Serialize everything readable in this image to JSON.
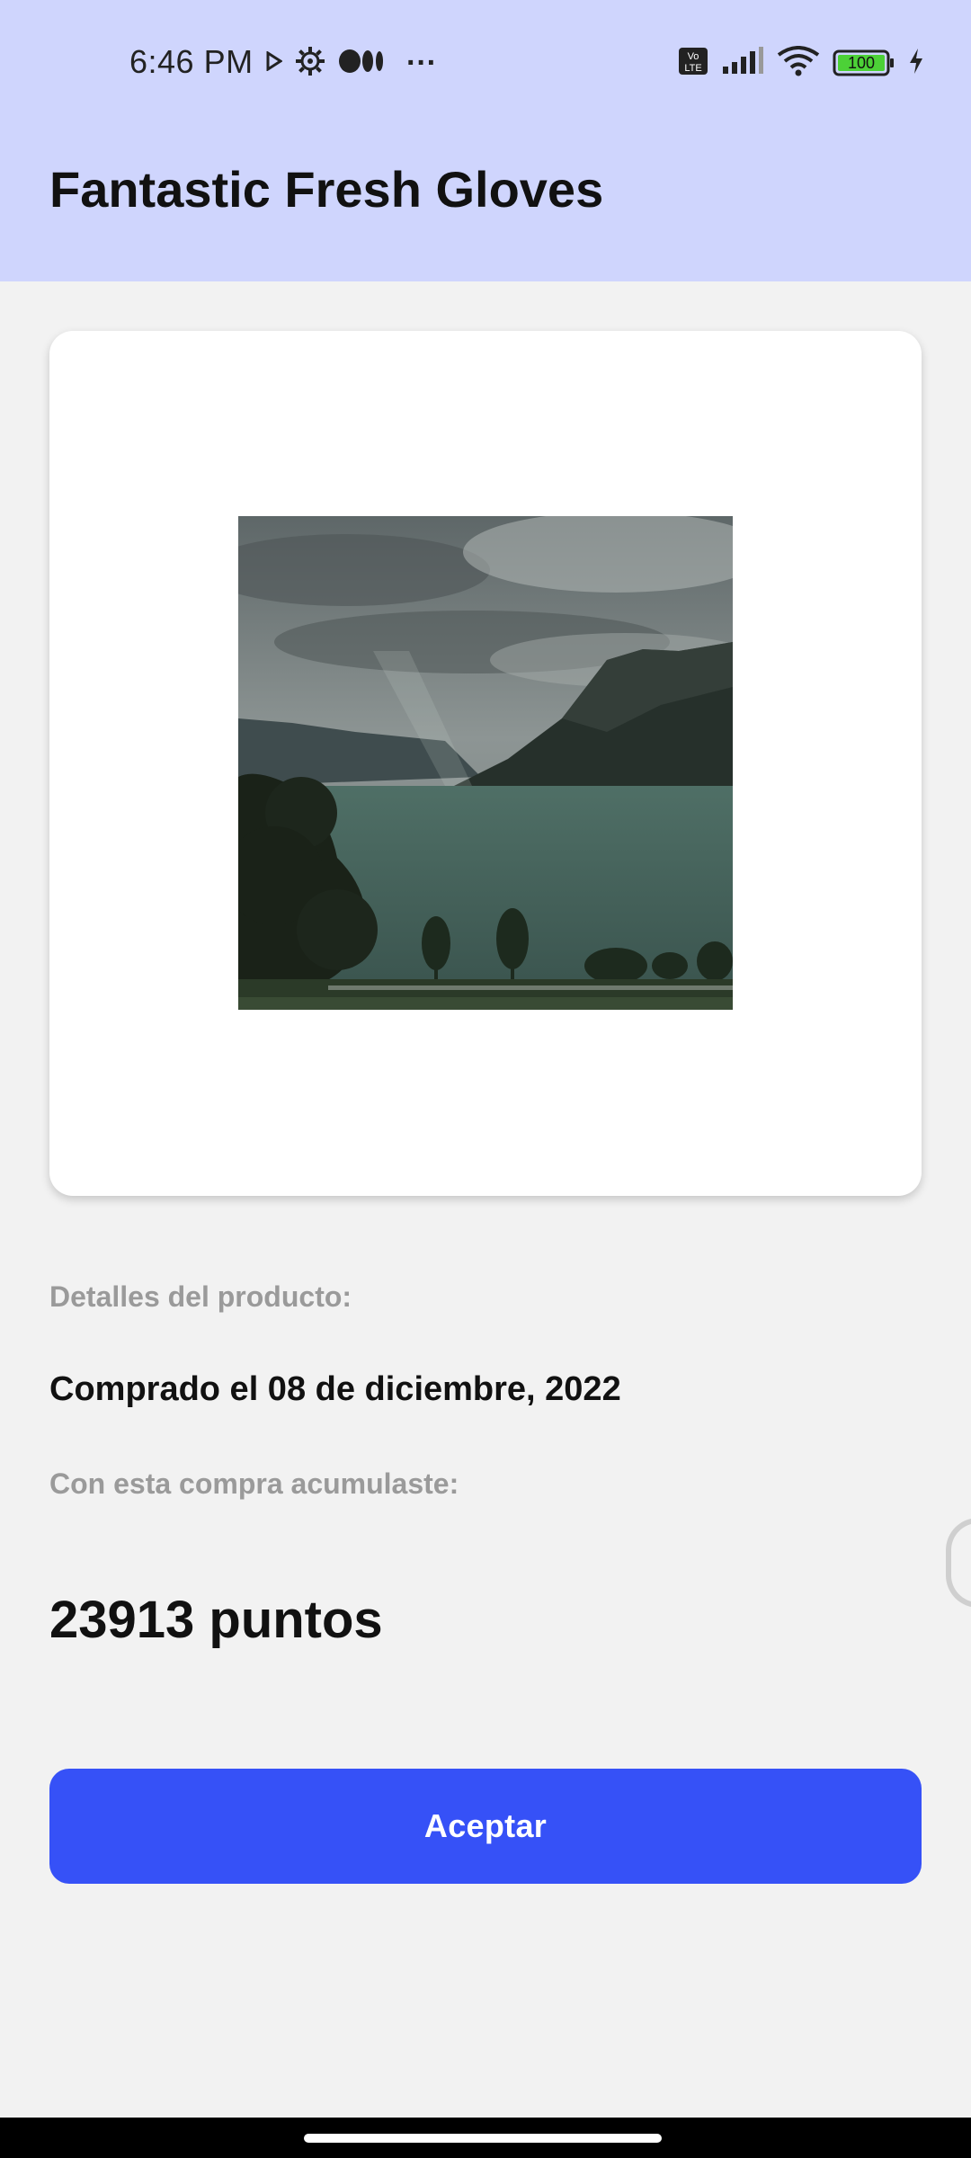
{
  "status_bar": {
    "time": "6:46 PM",
    "overflow_indicator": "···",
    "battery_level": "100",
    "left_icons": [
      "play-icon",
      "settings-gear-icon",
      "media-dots-icon"
    ],
    "right_icons": [
      "volte-icon",
      "signal-icon",
      "wifi-icon",
      "battery-icon",
      "charging-icon"
    ]
  },
  "header": {
    "title": "Fantastic Fresh Gloves"
  },
  "product": {
    "image_alt_icon": "product-photo-lake-landscape"
  },
  "details": {
    "section_label": "Detalles del producto:",
    "purchase_date": "Comprado el 08 de diciembre, 2022",
    "accumulated_label": "Con esta compra acumulaste:",
    "points": "23913 puntos"
  },
  "actions": {
    "accept_label": "Aceptar"
  },
  "colors": {
    "header_bg": "#cfd5fd",
    "page_bg": "#f2f2f2",
    "accent_button": "#3651f7",
    "muted_text": "#9a9a9a",
    "battery_green": "#4cd137"
  }
}
